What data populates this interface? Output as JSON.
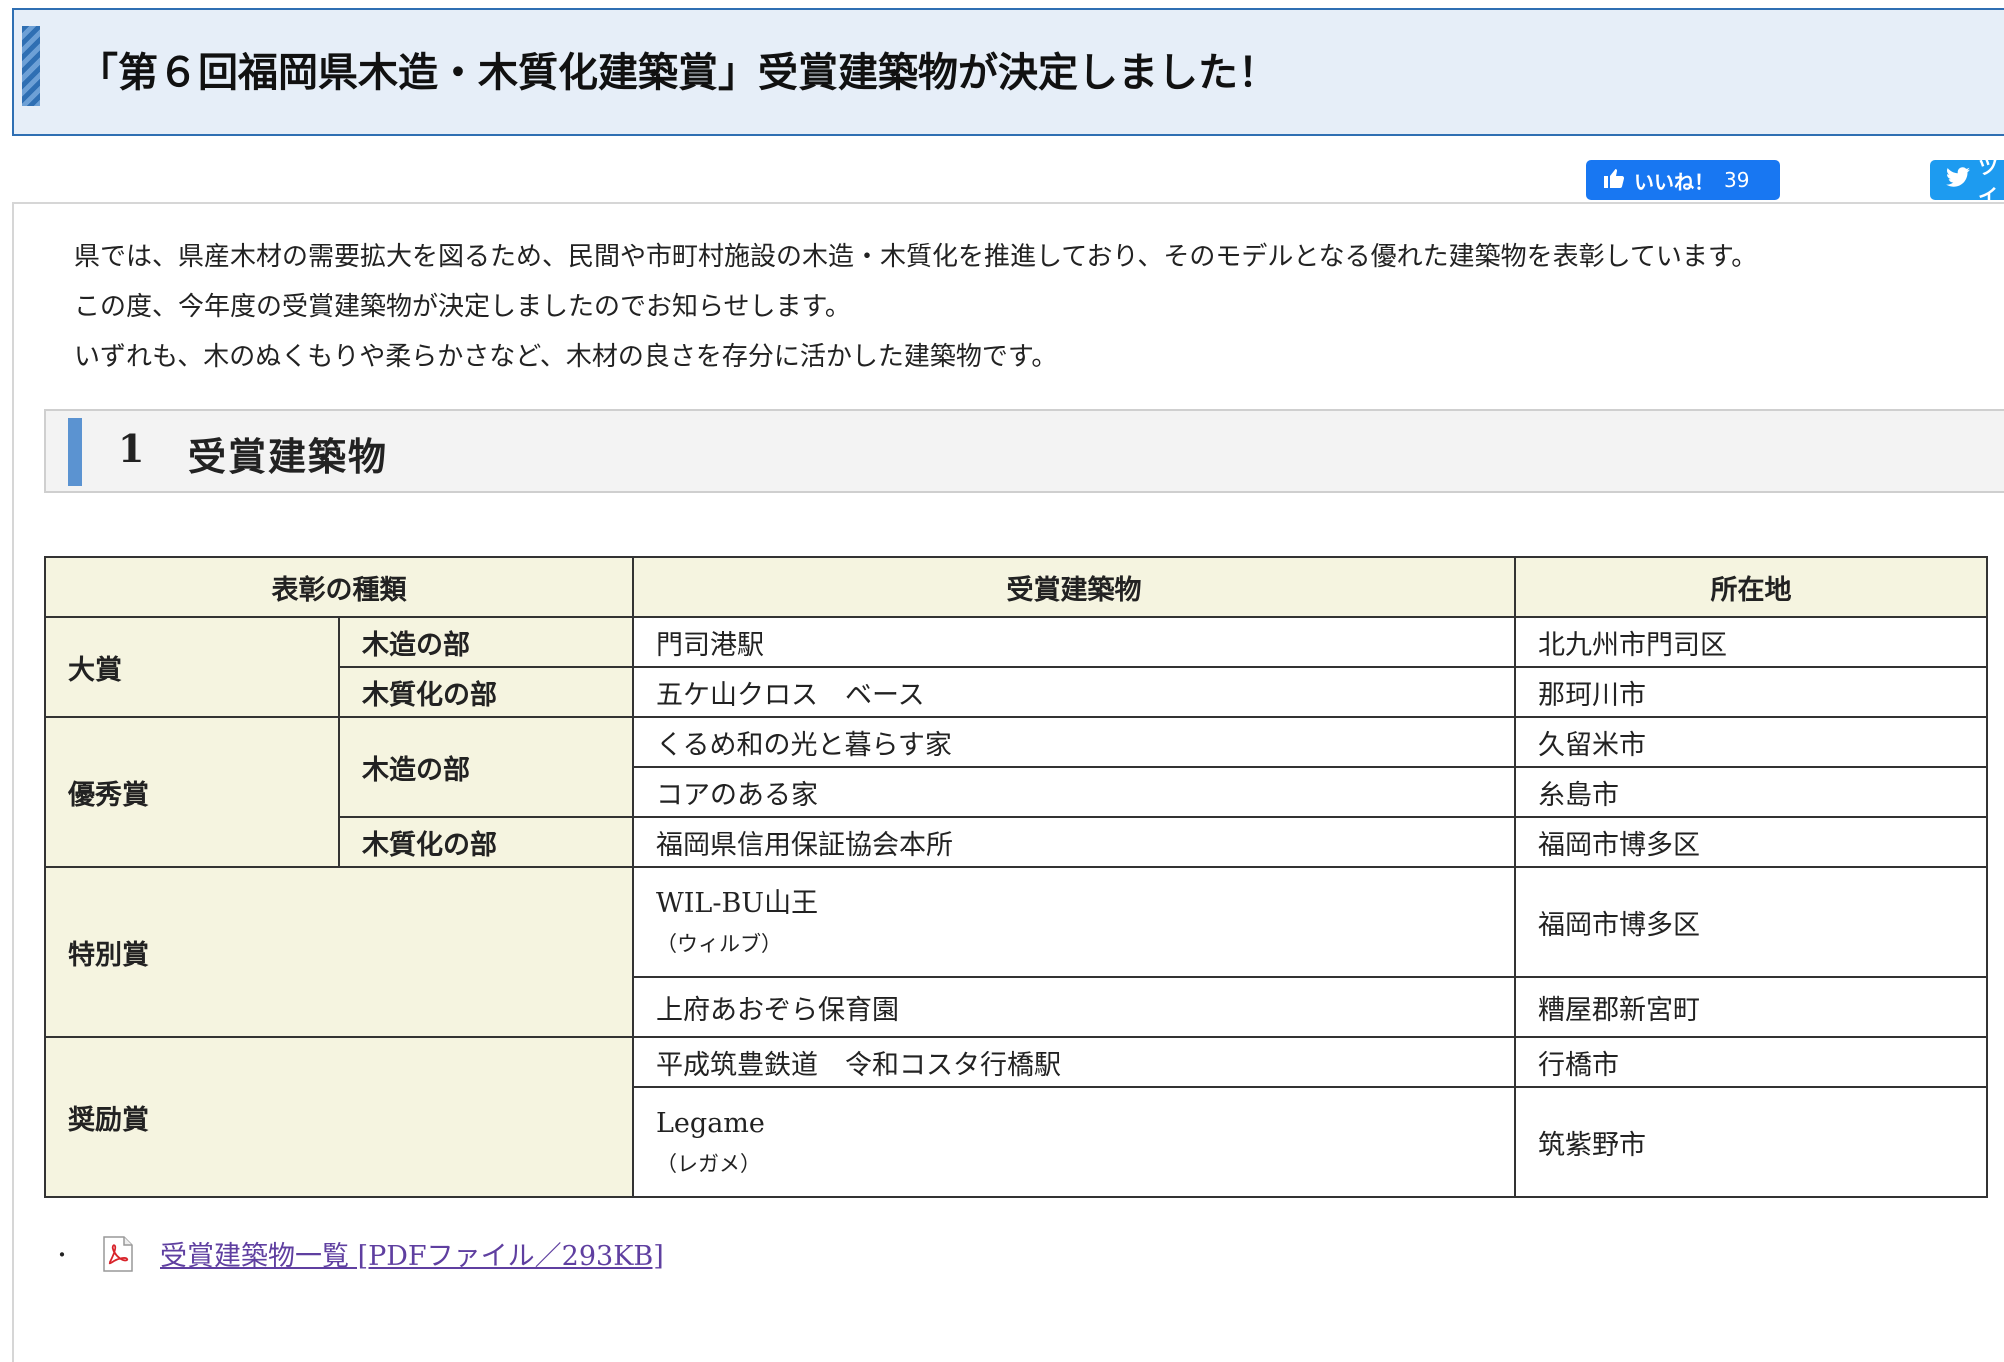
{
  "page_title": "「第６回福岡県木造・木質化建築賞」受賞建築物が決定しました！",
  "social": {
    "like_label": "いいね！",
    "like_count": "39",
    "tweet_label": "ツイ"
  },
  "intro": [
    "県では、県産木材の需要拡大を図るため、民間や市町村施設の木造・木質化を推進しており、そのモデルとなる優れた建築物を表彰しています。",
    "この度、今年度の受賞建築物が決定しましたのでお知らせします。",
    "いずれも、木のぬくもりや柔らかさなど、木材の良さを存分に活かした建築物です。"
  ],
  "section": {
    "number": "1",
    "title": "受賞建築物"
  },
  "table": {
    "headers": [
      "表彰の種類",
      "受賞建築物",
      "所在地"
    ],
    "categories": {
      "taisho": "大賞",
      "yushu": "優秀賞",
      "tokubetsu": "特別賞",
      "shorei": "奨励賞",
      "mokuzo": "木造の部",
      "mokushitsu": "木質化の部"
    },
    "rows": [
      {
        "building": "門司港駅",
        "location": "北九州市門司区"
      },
      {
        "building": "五ケ山クロス　ベース",
        "location": "那珂川市"
      },
      {
        "building": "くるめ和の光と暮らす家",
        "location": "久留米市"
      },
      {
        "building": "コアのある家",
        "location": "糸島市"
      },
      {
        "building": "福岡県信用保証協会本所",
        "location": "福岡市博多区"
      },
      {
        "building": "WIL-BU山王",
        "reading": "（ウィルブ）",
        "location": "福岡市博多区"
      },
      {
        "building": "上府あおぞら保育園",
        "location": "糟屋郡新宮町"
      },
      {
        "building": "平成筑豊鉄道　令和コスタ行橋駅",
        "location": "行橋市"
      },
      {
        "building": "Legame",
        "reading": "（レガメ）",
        "location": "筑紫野市"
      }
    ]
  },
  "pdf_link": {
    "bullet": "・",
    "label": "受賞建築物一覧 [PDFファイル／293KB]"
  },
  "colors": {
    "banner_bg": "#e6eef8",
    "banner_border": "#2f6fb3",
    "header_cell_bg": "#f5f4e0",
    "facebook_blue": "#1877f2",
    "twitter_blue": "#1d9bf0",
    "link_purple": "#5f3fa0"
  }
}
